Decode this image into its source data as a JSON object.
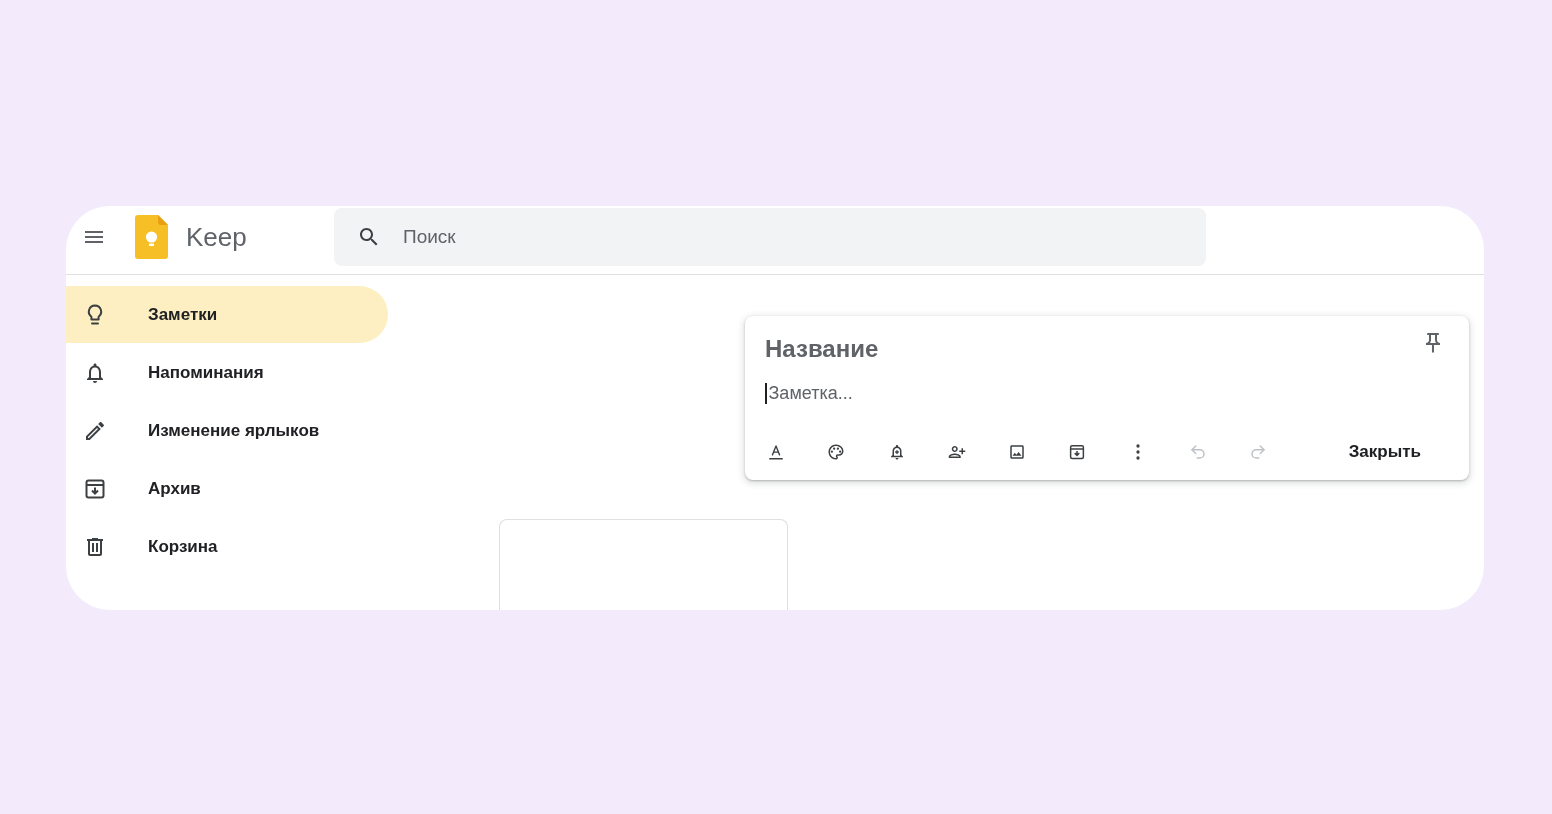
{
  "header": {
    "app_name": "Keep",
    "search": {
      "placeholder": "Поиск"
    }
  },
  "sidebar": {
    "items": [
      {
        "kind": "notes",
        "label": "Заметки",
        "selected": true
      },
      {
        "kind": "reminders",
        "label": "Напоминания",
        "selected": false
      },
      {
        "kind": "labels",
        "label": "Изменение ярлыков",
        "selected": false
      },
      {
        "kind": "archive",
        "label": "Архив",
        "selected": false
      },
      {
        "kind": "trash",
        "label": "Корзина",
        "selected": false
      }
    ]
  },
  "editor": {
    "title_field": {
      "placeholder": "Название"
    },
    "note_field": {
      "placeholder": "Заметка...",
      "focused": true
    },
    "tools": [
      {
        "kind": "format",
        "disabled": false
      },
      {
        "kind": "color",
        "disabled": false
      },
      {
        "kind": "remind",
        "disabled": false
      },
      {
        "kind": "collaborator",
        "disabled": false
      },
      {
        "kind": "image",
        "disabled": false
      },
      {
        "kind": "archive",
        "disabled": false
      },
      {
        "kind": "more",
        "disabled": false
      },
      {
        "kind": "undo",
        "disabled": true
      },
      {
        "kind": "redo",
        "disabled": true
      }
    ],
    "close_button": "Закрыть"
  }
}
